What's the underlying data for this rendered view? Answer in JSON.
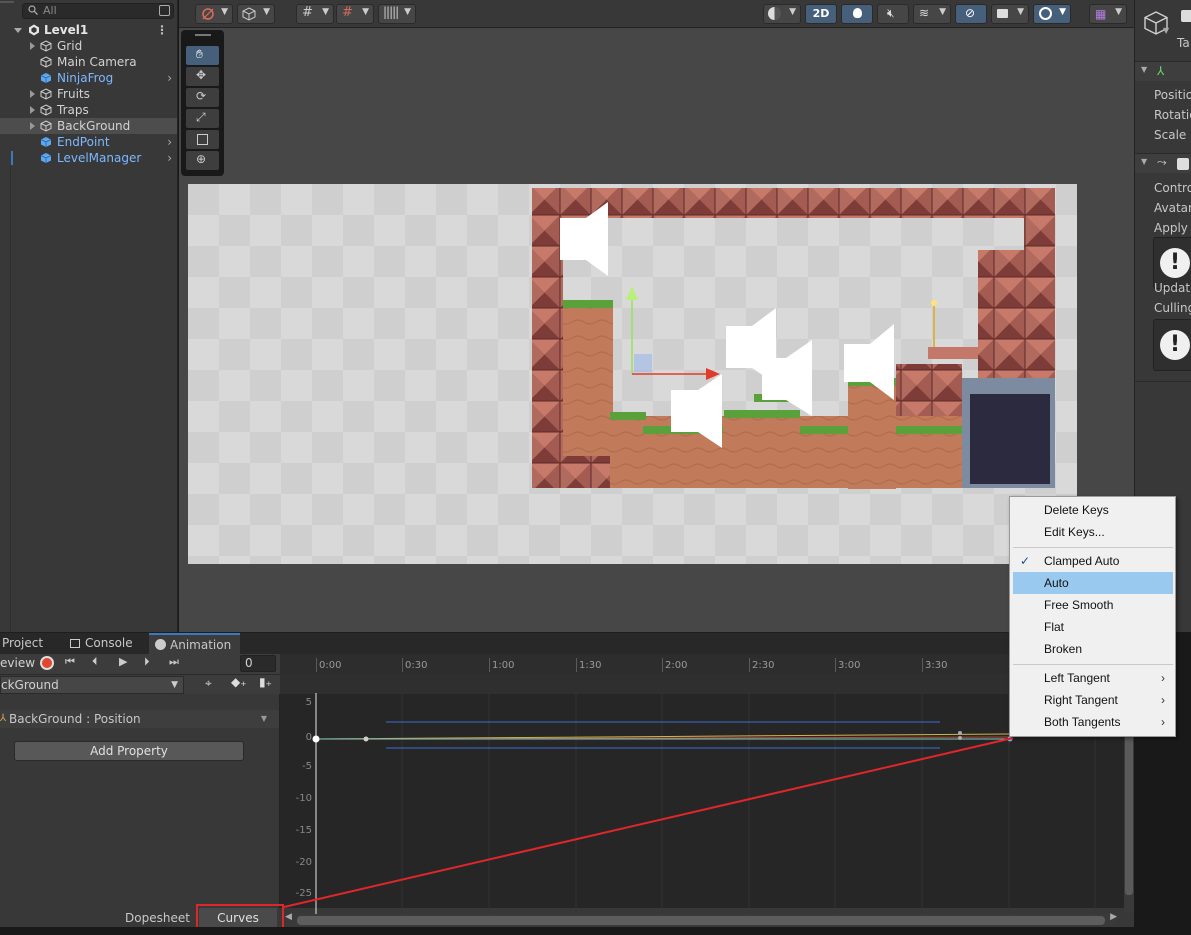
{
  "hierarchy": {
    "search_placeholder": "All",
    "scene_name": "Level1",
    "items": [
      {
        "label": "Grid"
      },
      {
        "label": "Main Camera"
      },
      {
        "label": "NinjaFrog"
      },
      {
        "label": "Fruits"
      },
      {
        "label": "Traps"
      },
      {
        "label": "BackGround"
      },
      {
        "label": "EndPoint"
      },
      {
        "label": "LevelManager"
      }
    ]
  },
  "scene_toolbar": {
    "mode_2d": "2D"
  },
  "inspector": {
    "tag_prefix": "Ta",
    "transform_fields": [
      "Positio",
      "Rotatio",
      "Scale"
    ],
    "animator_fields": [
      "Contro",
      "Avatar",
      "Apply I"
    ],
    "animator_fields2": [
      "Update",
      "Culling"
    ]
  },
  "bottom_panel": {
    "tabs": [
      "Project",
      "Console",
      "Animation"
    ],
    "preview_label": "eview",
    "frame_value": "0",
    "clip_name": "ckGround",
    "property_label": "BackGround : Position",
    "add_property": "Add Property",
    "dopesheet": "Dopesheet",
    "curves": "Curves"
  },
  "timeline": {
    "ticks": [
      "0:00",
      "0:30",
      "1:00",
      "1:30",
      "2:00",
      "2:30",
      "3:00",
      "3:30"
    ],
    "y_labels": [
      "5",
      "0",
      "-5",
      "-10",
      "-15",
      "-20",
      "-25"
    ]
  },
  "context_menu": {
    "items": [
      {
        "label": "Delete Keys"
      },
      {
        "label": "Edit Keys..."
      },
      {
        "label": "Clamped Auto",
        "checked": true
      },
      {
        "label": "Auto",
        "highlighted": true
      },
      {
        "label": "Free Smooth"
      },
      {
        "label": "Flat"
      },
      {
        "label": "Broken"
      },
      {
        "label": "Left Tangent",
        "submenu": true
      },
      {
        "label": "Right Tangent",
        "submenu": true
      },
      {
        "label": "Both Tangents",
        "submenu": true
      }
    ]
  },
  "colors": {
    "accent": "#3a79bb",
    "highlight_box": "#e0262b",
    "menu_highlight": "#99c9ef",
    "record": "#e0482e"
  }
}
